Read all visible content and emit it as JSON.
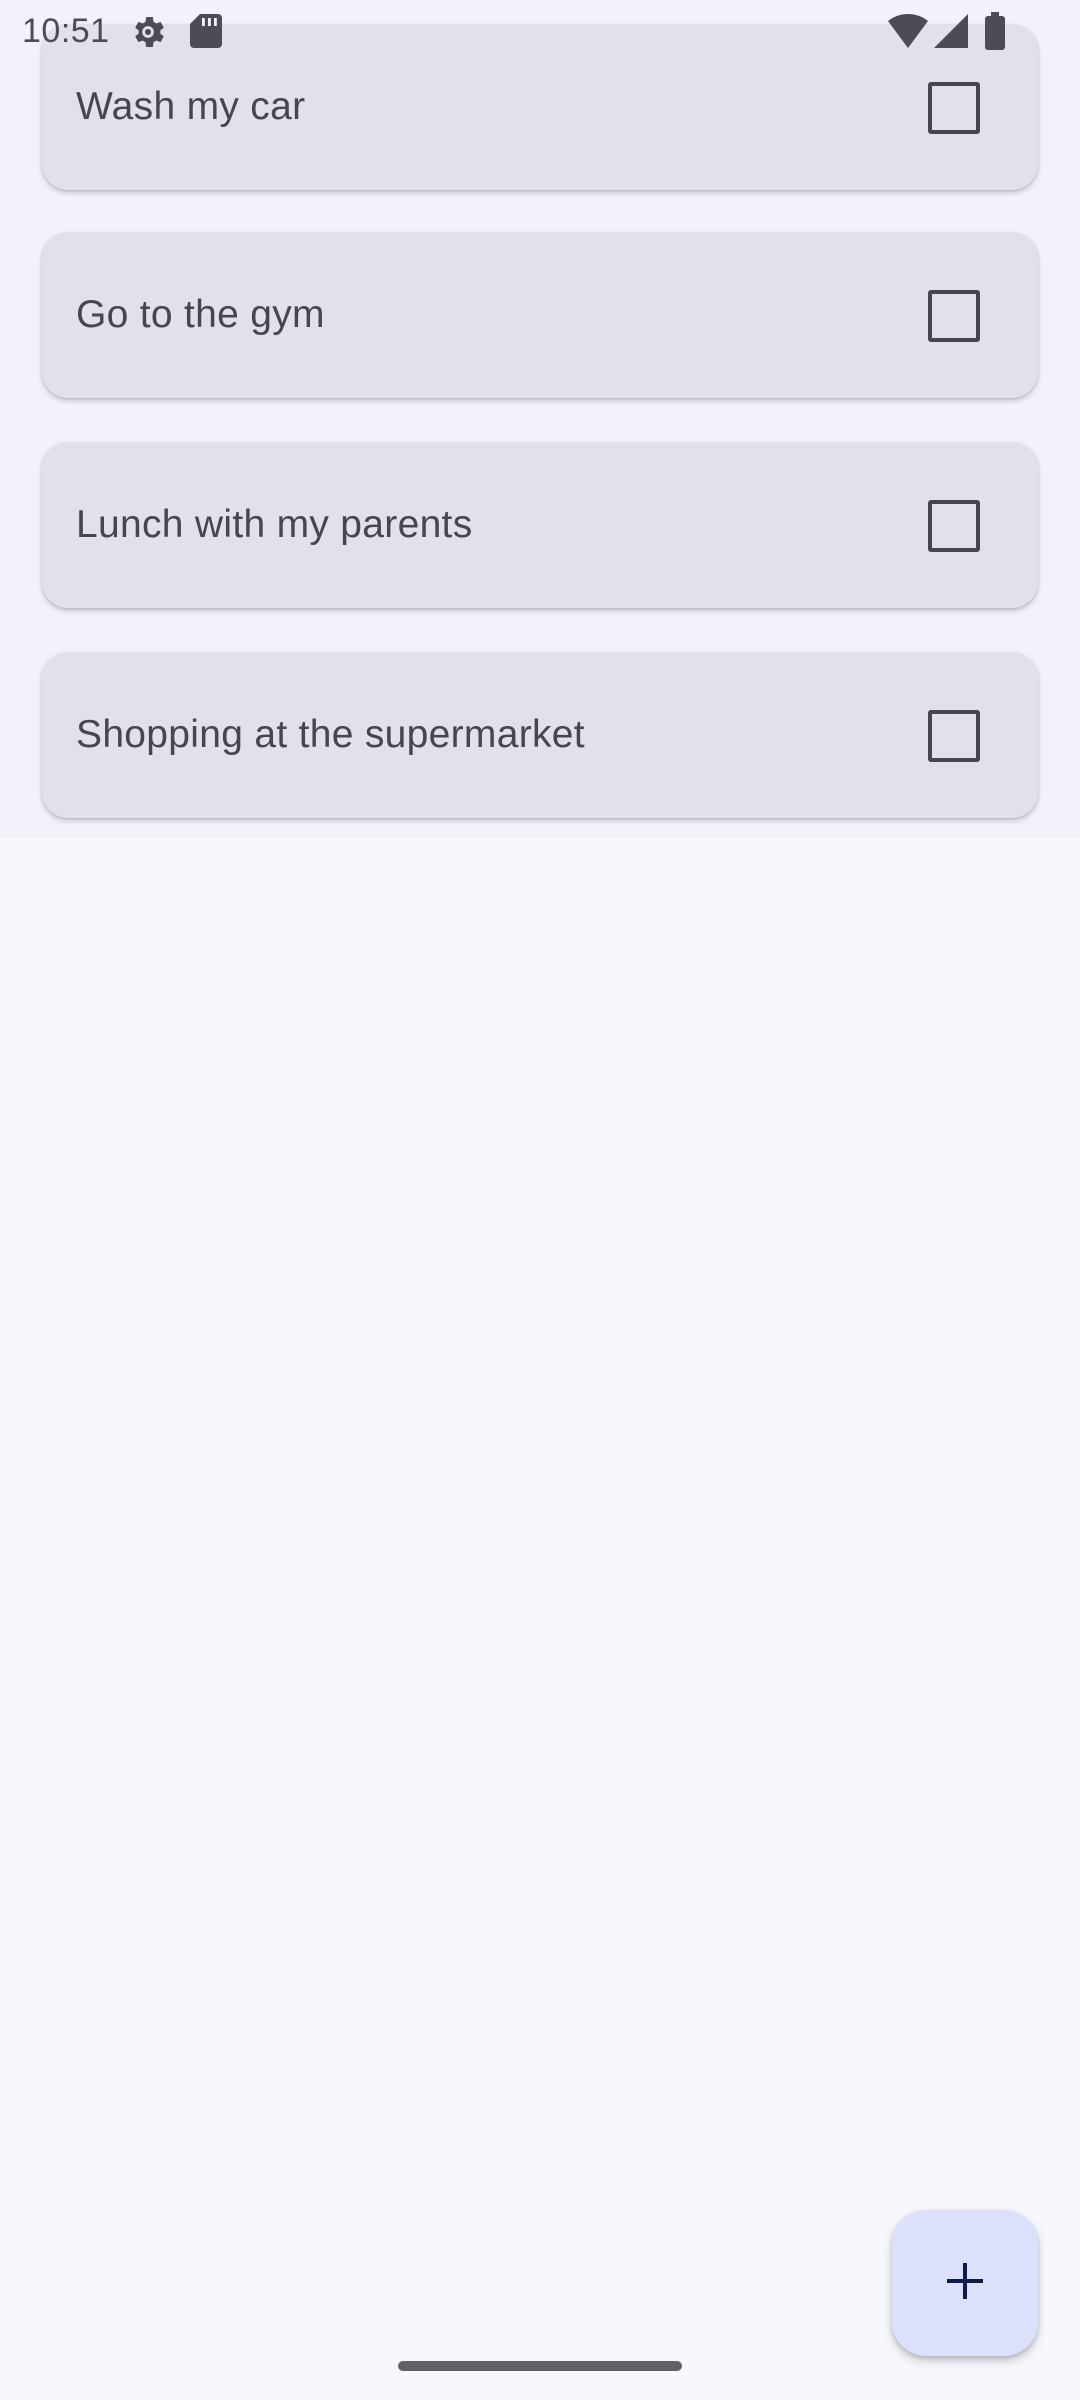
{
  "status_bar": {
    "time": "10:51",
    "icons": [
      "settings-gear-icon",
      "sd-card-icon",
      "wifi-icon",
      "cellular-signal-icon",
      "battery-icon"
    ]
  },
  "tasks": [
    {
      "label": "Wash my car",
      "checked": false
    },
    {
      "label": "Go to the gym",
      "checked": false
    },
    {
      "label": "Lunch with my parents",
      "checked": false
    },
    {
      "label": "Shopping at the supermarket",
      "checked": false
    }
  ],
  "fab": {
    "icon": "plus-icon"
  },
  "colors": {
    "background": "#F7F8FE",
    "card": "#E2E1EA",
    "fab": "#DCE1FB",
    "text": "#45464F",
    "fab_icon": "#0F1B4D"
  }
}
